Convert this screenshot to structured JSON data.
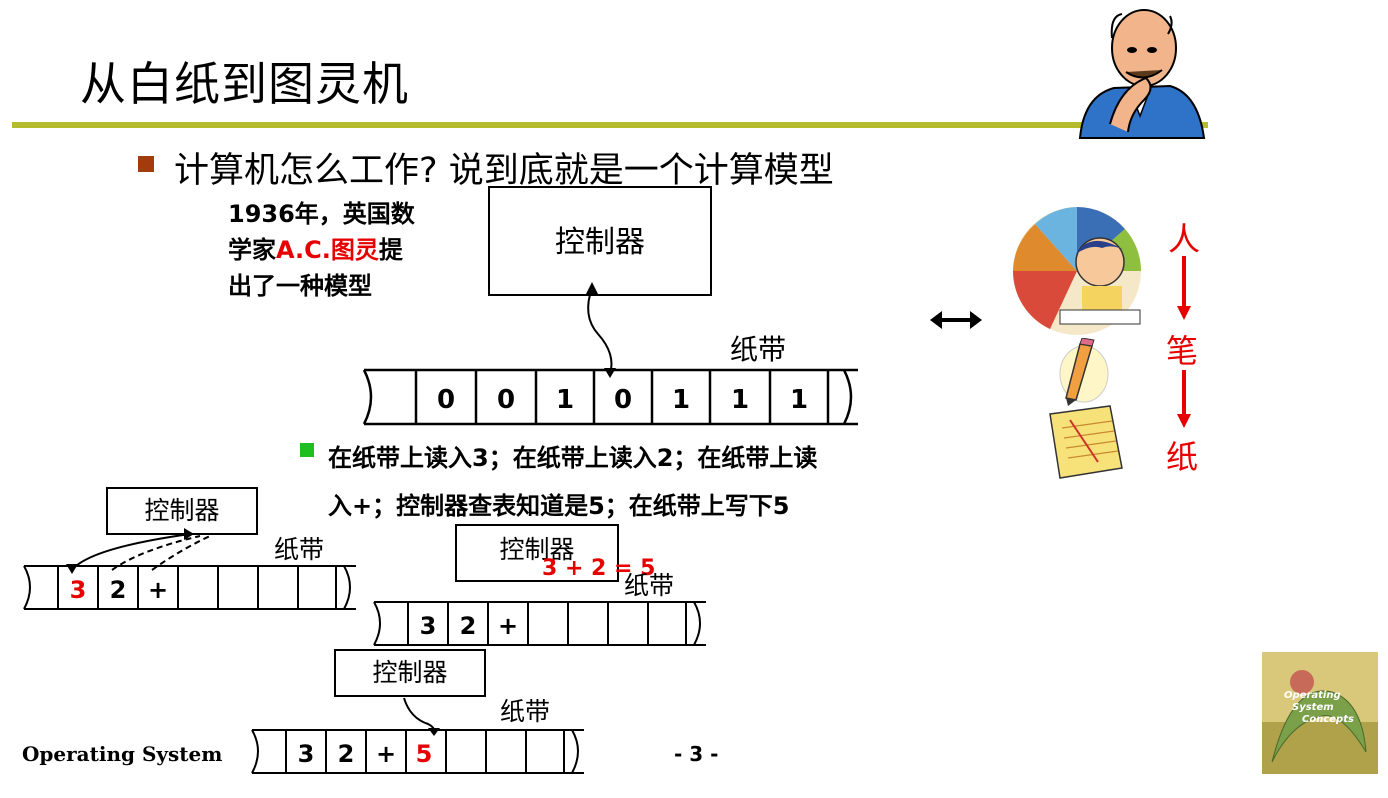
{
  "slide": {
    "title": "从白纸到图灵机",
    "bullet": "计算机怎么工作? 说到底就是一个计算模型",
    "note": {
      "line1": "1936年，英国数",
      "line2_pre": "学家",
      "line2_red": "A.C.图灵",
      "line2_post": "提",
      "line3": "出了一种模型"
    },
    "sub_bullet": {
      "line1": "在纸带上读入3；在纸带上读入2；在纸带上读",
      "line2": "入+；控制器查表知道是5；在纸带上写下5"
    },
    "footer_left": "Operating System",
    "page_number": "- 3 -"
  },
  "main_machine": {
    "controller_label": "控制器",
    "tape_label": "纸带",
    "cells": [
      "0",
      "0",
      "1",
      "0",
      "1",
      "1",
      "1"
    ]
  },
  "step1": {
    "controller_label": "控制器",
    "tape_label": "纸带",
    "cells": [
      "3",
      "2",
      "+",
      "",
      "",
      "",
      "",
      ""
    ]
  },
  "step2": {
    "controller_label": "控制器",
    "calc": "3 + 2 = 5",
    "tape_label": "纸带",
    "cells": [
      "3",
      "2",
      "+",
      "",
      "",
      "",
      "",
      ""
    ]
  },
  "step3": {
    "controller_label": "控制器",
    "tape_label": "纸带",
    "cells": [
      "3",
      "2",
      "+",
      "5",
      "",
      "",
      "",
      ""
    ]
  },
  "right_panel": {
    "person": "人",
    "pen": "笔",
    "paper": "纸"
  },
  "colors": {
    "title_rule": "#b5bd2f",
    "main_bullet": "#a33b0f",
    "sub_bullet": "#1fbf1f",
    "accent_red": "#e60000"
  },
  "icons": [
    "thinking-man-icon",
    "child-writing-icon",
    "pencil-icon",
    "notepad-icon",
    "double-arrow-icon",
    "book-cover-icon"
  ]
}
